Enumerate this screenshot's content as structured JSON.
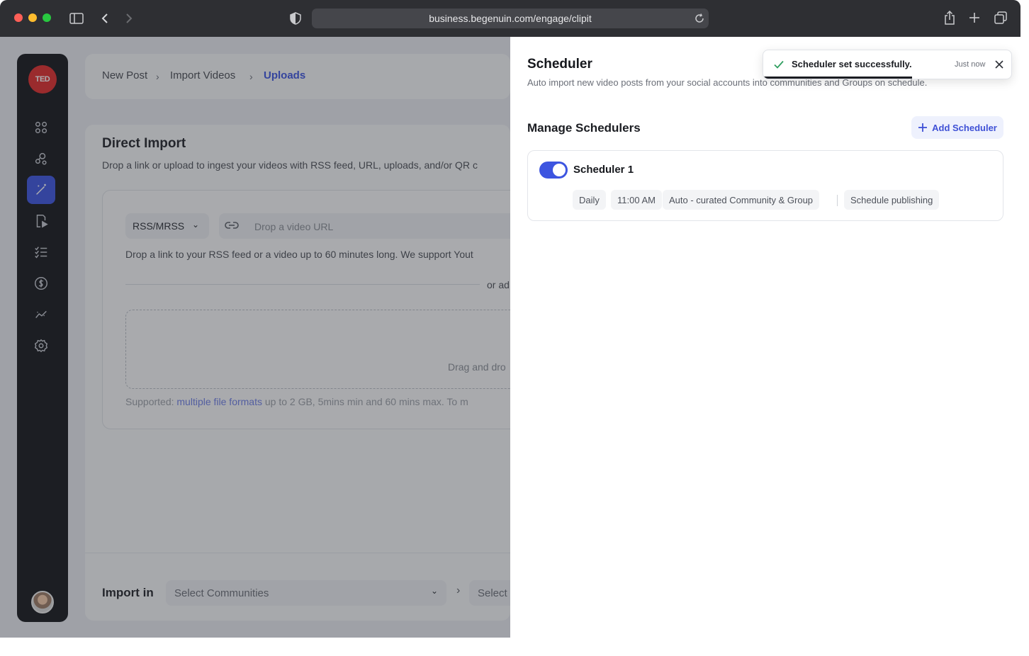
{
  "browser": {
    "url": "business.begenuin.com/engage/clipit"
  },
  "sidebar": {
    "logo": "TED",
    "items": [
      {
        "icon": "grid-icon",
        "active": false
      },
      {
        "icon": "communities-icon",
        "active": false
      },
      {
        "icon": "magic-wand-icon",
        "active": true
      },
      {
        "icon": "video-import-icon",
        "active": false
      },
      {
        "icon": "checklist-icon",
        "active": false
      },
      {
        "icon": "dollar-icon",
        "active": false
      },
      {
        "icon": "analytics-icon",
        "active": false
      },
      {
        "icon": "gear-icon",
        "active": false
      }
    ]
  },
  "breadcrumb": {
    "items": [
      "New Post",
      "Import Videos",
      "Uploads"
    ]
  },
  "direct_import": {
    "title": "Direct Import",
    "description": "Drop a link or upload to ingest your videos with RSS feed, URL, uploads, and/or QR c",
    "source_select": "RSS/MRSS",
    "url_placeholder": "Drop a video URL",
    "hint": "Drop a link to your RSS feed or a video up to 60 minutes long. We support Yout",
    "divider_text": "or ad",
    "dropzone_text": "Drag and dro",
    "supported_prefix": "Supported: ",
    "supported_link": "multiple file formats",
    "supported_suffix": " up to 2 GB, 5mins min and 60 mins max. To m"
  },
  "import_in": {
    "label": "Import in",
    "communities_placeholder": "Select Communities",
    "next_placeholder": "Select"
  },
  "drawer": {
    "title": "Scheduler",
    "subtitle": "Auto import new video posts from your social accounts into communities and Groups on schedule.",
    "manage_title": "Manage Schedulers",
    "add_button": "Add Scheduler",
    "schedulers": [
      {
        "name": "Scheduler 1",
        "enabled": true,
        "frequency": "Daily",
        "time": "11:00 AM",
        "target": "Auto - curated Community & Group",
        "mode": "Schedule publishing"
      }
    ]
  },
  "toast": {
    "message": "Scheduler set successfully.",
    "time": "Just now",
    "progress": 0.6
  },
  "colors": {
    "accent": "#3d55e0",
    "sidebar_bg": "#15171c",
    "logo_red": "#e02c2c",
    "success": "#2f9e5f"
  }
}
